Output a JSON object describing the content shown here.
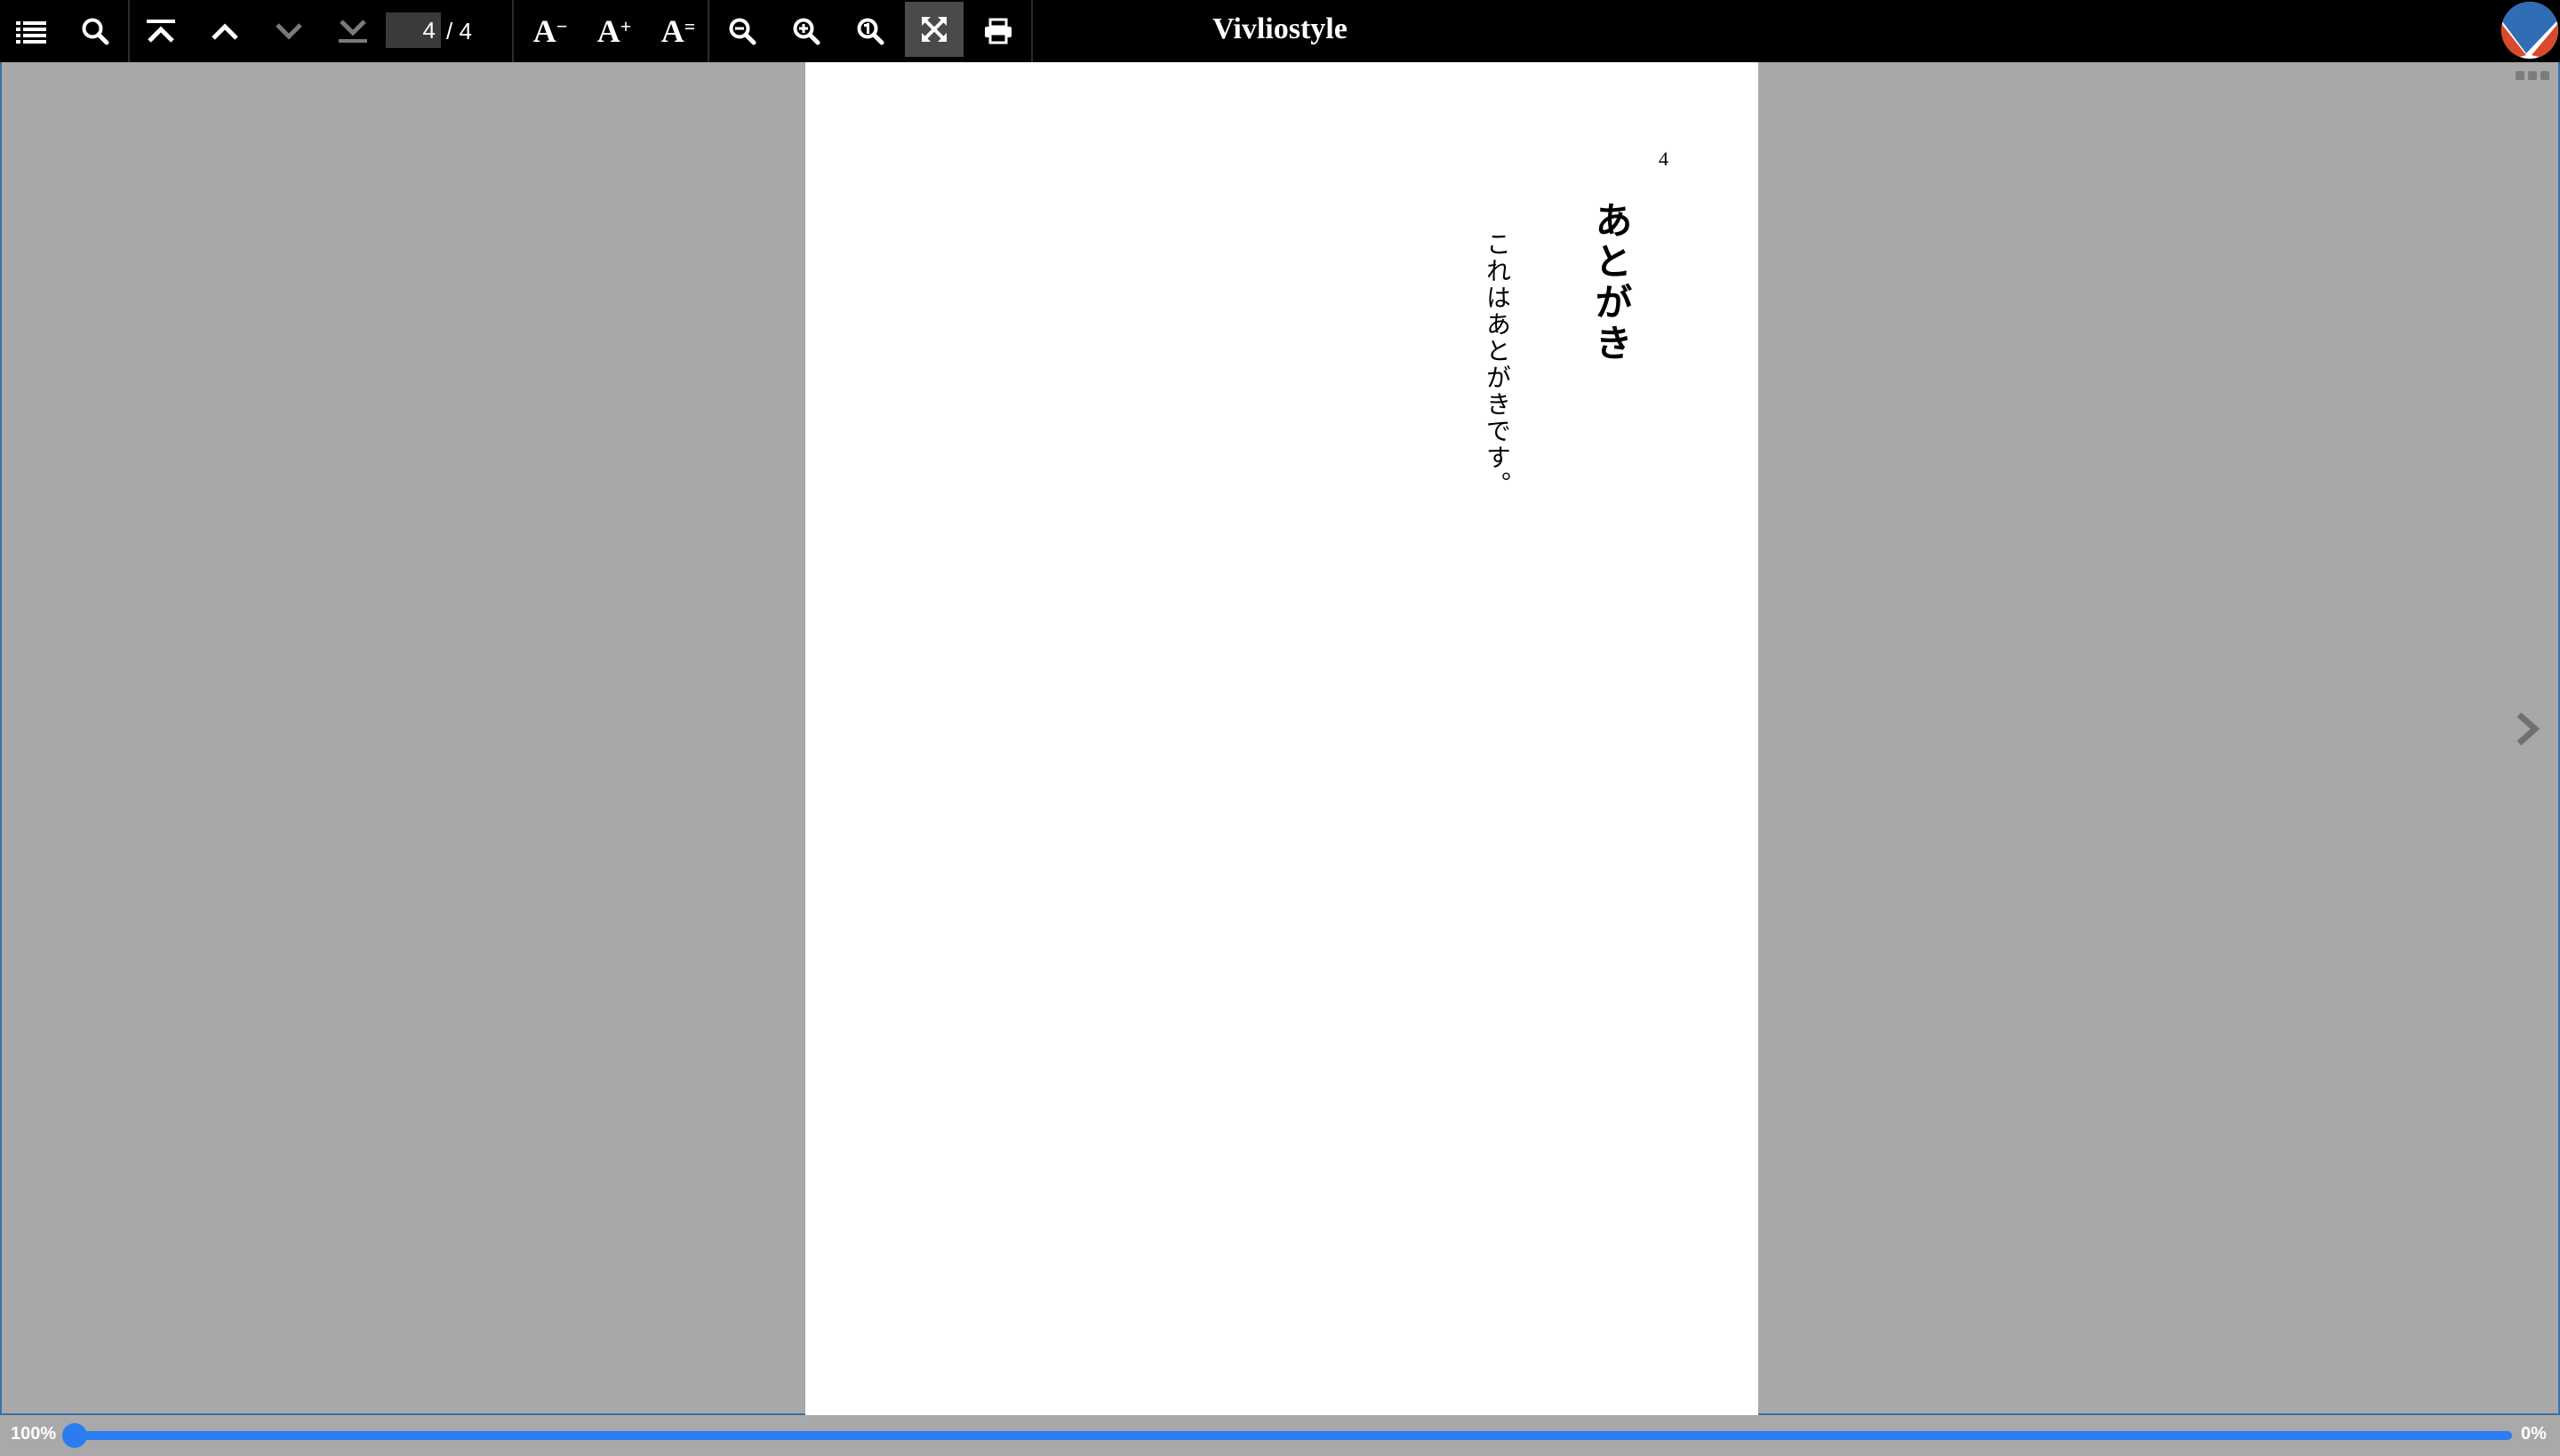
{
  "app": {
    "title": "Vivliostyle"
  },
  "toolbar": {
    "buttons": [
      {
        "name": "table-of-contents-button",
        "icon": "list-icon"
      },
      {
        "name": "search-button",
        "icon": "search-icon"
      },
      {
        "name": "first-page-button",
        "icon": "first-page-icon"
      },
      {
        "name": "previous-page-button",
        "icon": "chevron-up-icon"
      },
      {
        "name": "next-page-button",
        "icon": "chevron-down-icon"
      },
      {
        "name": "last-page-button",
        "icon": "last-page-icon"
      },
      {
        "name": "font-size-decrease-button",
        "icon": "font-decrease-icon"
      },
      {
        "name": "font-size-increase-button",
        "icon": "font-increase-icon"
      },
      {
        "name": "font-size-reset-button",
        "icon": "font-reset-icon"
      },
      {
        "name": "zoom-out-button",
        "icon": "zoom-out-icon"
      },
      {
        "name": "zoom-in-button",
        "icon": "zoom-in-icon"
      },
      {
        "name": "zoom-actual-size-button",
        "icon": "zoom-actual-icon"
      },
      {
        "name": "fit-to-screen-button",
        "icon": "fit-screen-icon"
      },
      {
        "name": "print-button",
        "icon": "print-icon"
      }
    ],
    "page_navigation": {
      "current_page": "4",
      "total_label": "/ 4"
    },
    "font_labels": {
      "letter": "A",
      "decrease": "−",
      "increase": "+",
      "reset": "="
    }
  },
  "document": {
    "page_number": "4",
    "chapter_title": "あとがき",
    "body_text": "これはあとがきです。"
  },
  "bottom_bar": {
    "zoom_label": "100%",
    "progress": 0,
    "progress_label": "0%"
  },
  "colors": {
    "accent": "#2a7cf0",
    "viewer_background": "#a8a8a8",
    "toolbar_background": "#000000"
  }
}
